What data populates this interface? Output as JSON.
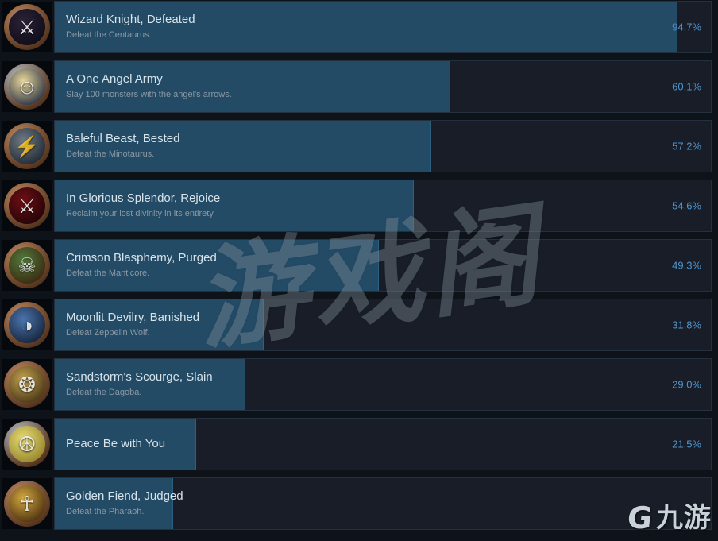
{
  "colors": {
    "page_background": "#0e131a",
    "bar_unfilled": "#181d27",
    "bar_filled": "#234b66",
    "bar_border": "#24303d",
    "title_text": "#d6e3ea",
    "description_text": "#8b98a4",
    "percent_text": "#4f94cd"
  },
  "achievements": [
    {
      "title": "Wizard Knight, Defeated",
      "description": "Defeat the Centaurus.",
      "percent_label": "94.7%",
      "percent_value": 94.7,
      "icon_name": "wizard-knight-icon",
      "icon_glyph": "⚔",
      "icon_ring": "#c08a62",
      "icon_fill_a": "#2a2238",
      "icon_fill_b": "#0c0a14"
    },
    {
      "title": "A One Angel Army",
      "description": "Slay 100 monsters with the angel's arrows.",
      "percent_label": "60.1%",
      "percent_value": 60.1,
      "icon_name": "angel-archer-icon",
      "icon_glyph": "☺",
      "icon_ring": "#b8c2cc",
      "icon_fill_a": "#e8d79a",
      "icon_fill_b": "#15203a"
    },
    {
      "title": "Baleful Beast, Bested",
      "description": "Defeat the Minotaurus.",
      "percent_label": "57.2%",
      "percent_value": 57.2,
      "icon_name": "minotaur-icon",
      "icon_glyph": "⚡",
      "icon_ring": "#c08a62",
      "icon_fill_a": "#6e7a84",
      "icon_fill_b": "#17202b"
    },
    {
      "title": "In Glorious Splendor, Rejoice",
      "description": "Reclaim your lost divinity in its entirety.",
      "percent_label": "54.6%",
      "percent_value": 54.6,
      "icon_name": "crossed-swords-icon",
      "icon_glyph": "⚔",
      "icon_ring": "#c08a62",
      "icon_fill_a": "#6e0f14",
      "icon_fill_b": "#1a0306"
    },
    {
      "title": "Crimson Blasphemy, Purged",
      "description": "Defeat the Manticore.",
      "percent_label": "49.3%",
      "percent_value": 49.3,
      "icon_name": "manticore-icon",
      "icon_glyph": "☠",
      "icon_ring": "#c08a62",
      "icon_fill_a": "#4f7a3a",
      "icon_fill_b": "#3a1e0c"
    },
    {
      "title": "Moonlit Devilry, Banished",
      "description": "Defeat Zeppelin Wolf.",
      "percent_label": "31.8%",
      "percent_value": 31.8,
      "icon_name": "zeppelin-wolf-icon",
      "icon_glyph": "◑",
      "icon_ring": "#c08a62",
      "icon_fill_a": "#4a74ac",
      "icon_fill_b": "#101a2e"
    },
    {
      "title": "Sandstorm's Scourge, Slain",
      "description": "Defeat the Dagoba.",
      "percent_label": "29.0%",
      "percent_value": 29.0,
      "icon_name": "dagoba-icon",
      "icon_glyph": "❂",
      "icon_ring": "#c08a62",
      "icon_fill_a": "#c2a24e",
      "icon_fill_b": "#3a2a10"
    },
    {
      "title": "Peace Be with You",
      "description": "",
      "percent_label": "21.5%",
      "percent_value": 21.5,
      "icon_name": "peace-icon",
      "icon_glyph": "☮",
      "icon_ring": "#b8c2cc",
      "icon_fill_a": "#e8dc74",
      "icon_fill_b": "#8a7a22"
    },
    {
      "title": "Golden Fiend, Judged",
      "description": "Defeat the Pharaoh.",
      "percent_label": "",
      "percent_value": 18.0,
      "icon_name": "pharaoh-icon",
      "icon_glyph": "☥",
      "icon_ring": "#c08a62",
      "icon_fill_a": "#d2a840",
      "icon_fill_b": "#3c2208"
    }
  ],
  "watermarks": {
    "center_text": "游戏阁",
    "logo_mark": "G",
    "logo_text": "九游"
  }
}
